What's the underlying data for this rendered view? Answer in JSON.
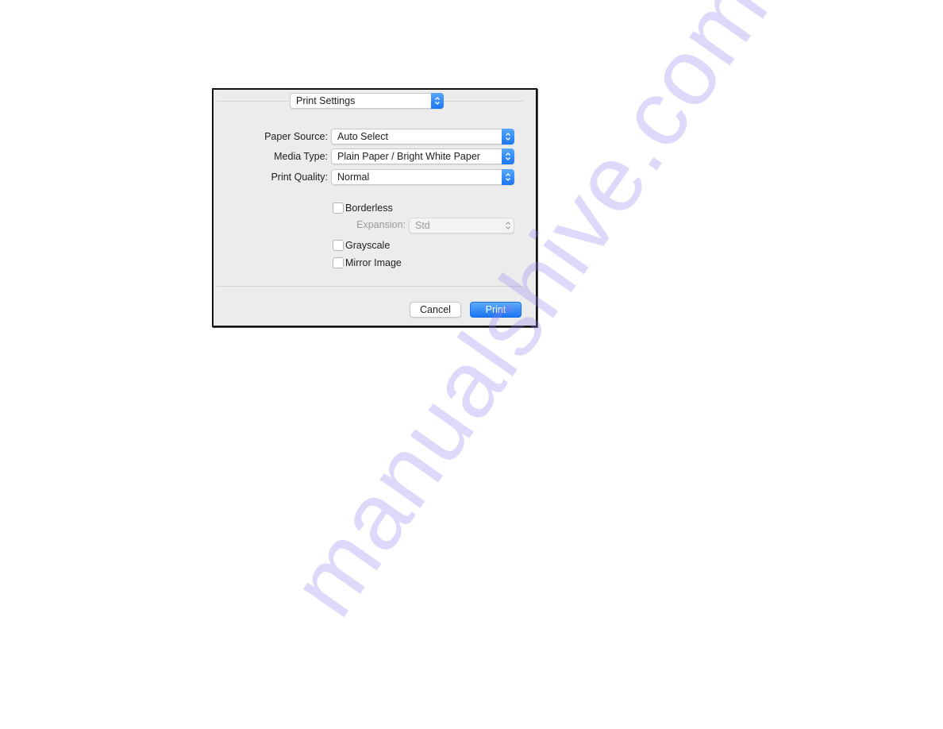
{
  "watermark": "manualshive.com",
  "dialog": {
    "pane_selector": {
      "value": "Print Settings"
    },
    "fields": [
      {
        "label": "Paper Source:",
        "value": "Auto Select"
      },
      {
        "label": "Media Type:",
        "value": "Plain Paper / Bright White Paper"
      },
      {
        "label": "Print Quality:",
        "value": "Normal"
      }
    ],
    "borderless": {
      "label": "Borderless",
      "checked": false
    },
    "expansion": {
      "label": "Expansion:",
      "value": "Std",
      "enabled": false
    },
    "grayscale": {
      "label": "Grayscale",
      "checked": false
    },
    "mirror_image": {
      "label": "Mirror Image",
      "checked": false
    },
    "buttons": {
      "cancel": "Cancel",
      "print": "Print"
    },
    "colors": {
      "accent": "#1c76f2",
      "panel": "#ececec"
    }
  }
}
